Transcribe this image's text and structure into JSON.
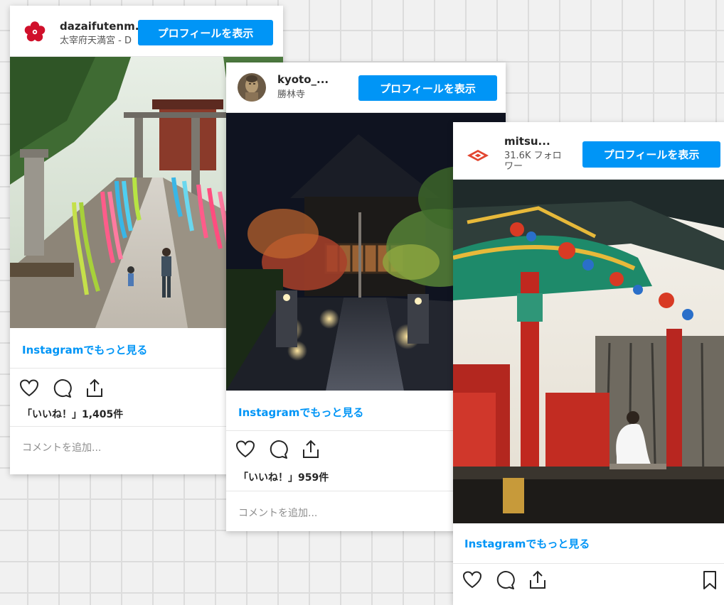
{
  "cards": [
    {
      "username": "dazaifutenm...",
      "subtitle": "太宰府天満宮 - D",
      "profile_button": "プロフィールを表示",
      "more_link": "Instagramでもっと見る",
      "likes": "「いいね！」1,405件",
      "comment_placeholder": "コメントを追加..."
    },
    {
      "username": "kyoto_...",
      "subtitle": "勝林寺",
      "profile_button": "プロフィールを表示",
      "more_link": "Instagramでもっと見る",
      "likes": "「いいね！」959件",
      "comment_placeholder": "コメントを追加..."
    },
    {
      "username": "mitsu...",
      "subtitle": "31.6K フォロワー",
      "profile_button": "プロフィールを表示",
      "more_link": "Instagramでもっと見る"
    }
  ],
  "colors": {
    "accent": "#0095f6",
    "grid_background": "#f1f1f1",
    "grid_line": "#dcdcdc"
  },
  "icons": [
    "heart-icon",
    "comment-icon",
    "share-icon",
    "bookmark-icon"
  ]
}
